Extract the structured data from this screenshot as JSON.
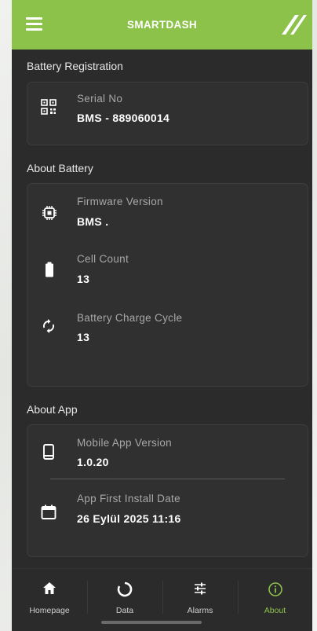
{
  "header": {
    "title": "SMARTDASH"
  },
  "sections": {
    "registration": {
      "title": "Battery Registration",
      "serial_label": "Serial No",
      "serial_value": "BMS - 889060014"
    },
    "about_battery": {
      "title": "About Battery",
      "firmware_label": "Firmware Version",
      "firmware_value": "BMS .",
      "cell_label": "Cell Count",
      "cell_value": "13",
      "cycle_label": "Battery Charge Cycle",
      "cycle_value": "13"
    },
    "about_app": {
      "title": "About App",
      "version_label": "Mobile App Version",
      "version_value": "1.0.20",
      "install_label": "App First Install Date",
      "install_value": "26 Eylül 2025 11:16"
    }
  },
  "nav": {
    "items": [
      {
        "label": "Homepage",
        "icon": "home-icon"
      },
      {
        "label": "Data",
        "icon": "data-ring-icon"
      },
      {
        "label": "Alarms",
        "icon": "sliders-icon"
      },
      {
        "label": "About",
        "icon": "info-icon"
      }
    ],
    "active_index": 3
  },
  "colors": {
    "accent": "#8cc24a",
    "background": "#2b2b2b",
    "card": "#303030"
  }
}
